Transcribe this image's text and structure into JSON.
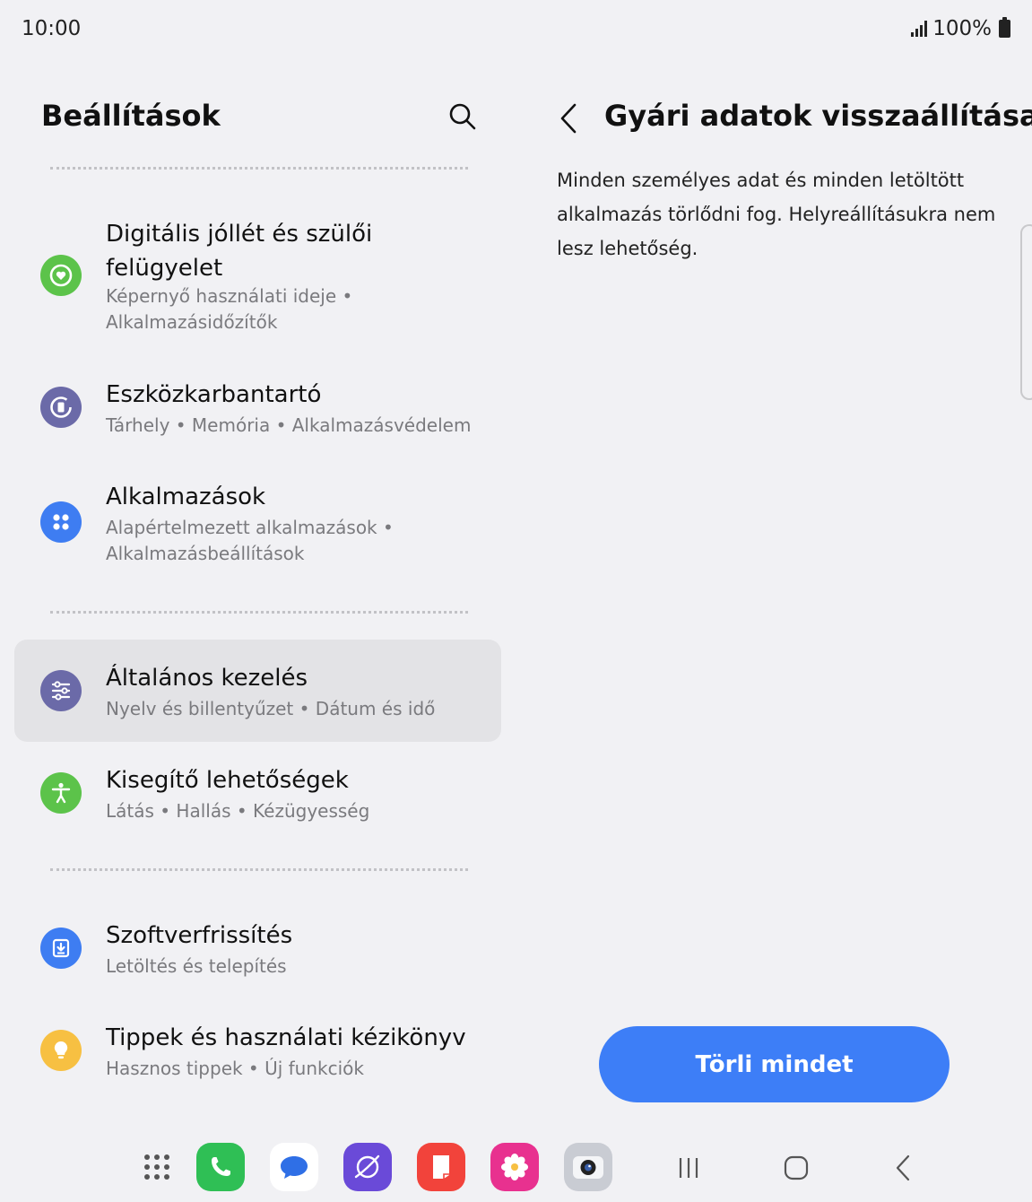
{
  "status": {
    "time": "10:00",
    "battery": "100%"
  },
  "settings": {
    "title": "Beállítások",
    "items": [
      {
        "title": "Digitális jóllét és szülői felügyelet",
        "subtitle": "Képernyő használati ideje  •  Alkalmazásidőzítők",
        "icon": "wellbeing-icon",
        "color": "#5cc34a"
      },
      {
        "title": "Eszközkarbantartó",
        "subtitle": "Tárhely  •  Memória  •  Alkalmazásvédelem",
        "icon": "device-care-icon",
        "color": "#6b6aa8"
      },
      {
        "title": "Alkalmazások",
        "subtitle": "Alapértelmezett alkalmazások  •  Alkalmazásbeállítások",
        "icon": "apps-icon",
        "color": "#3e7df2"
      },
      {
        "title": "Általános kezelés",
        "subtitle": "Nyelv és billentyűzet  •  Dátum és idő",
        "icon": "sliders-icon",
        "color": "#6b6aa8"
      },
      {
        "title": "Kisegítő lehetőségek",
        "subtitle": "Látás  •  Hallás  •  Kézügyesség",
        "icon": "accessibility-icon",
        "color": "#5cc34a"
      },
      {
        "title": "Szoftverfrissítés",
        "subtitle": "Letöltés és telepítés",
        "icon": "software-update-icon",
        "color": "#3e7df2"
      },
      {
        "title": "Tippek és használati kézikönyv",
        "subtitle": "Hasznos tippek  •  Új funkciók",
        "icon": "lightbulb-icon",
        "color": "#f7c042"
      }
    ]
  },
  "detail": {
    "title": "Gyári adatok visszaállítása",
    "description": "Minden személyes adat és minden letöltött alkalmazás törlődni fog. Helyreállításukra nem lesz lehetőség.",
    "button_label": "Törli mindet"
  },
  "taskbar": {
    "apps": [
      "apps-grid-icon",
      "phone-icon",
      "messages-icon",
      "internet-icon",
      "notes-icon",
      "gallery-icon",
      "camera-icon"
    ],
    "nav": [
      "recents-icon",
      "home-icon",
      "back-icon"
    ]
  }
}
